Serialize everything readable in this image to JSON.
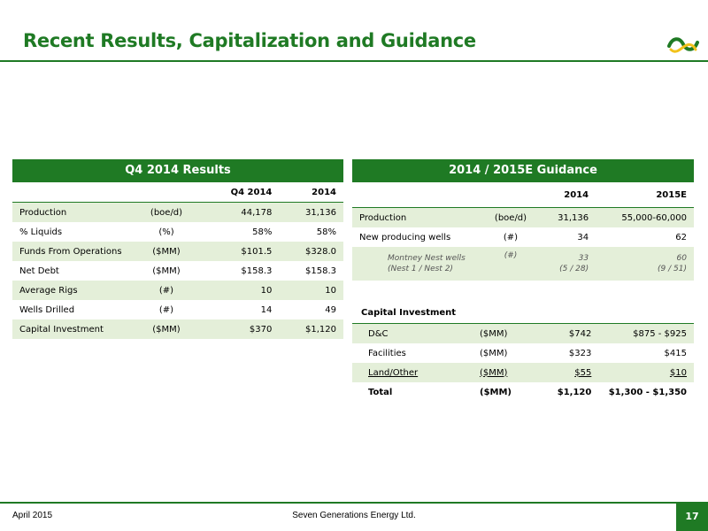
{
  "title": "Recent Results, Capitalization and Guidance",
  "left": {
    "heading": "Q4 2014 Results",
    "columns": [
      "",
      "",
      "Q4 2014",
      "2014"
    ],
    "rows": [
      {
        "label": "Production",
        "unit": "(boe/d)",
        "a": "44,178",
        "b": "31,136"
      },
      {
        "label": "% Liquids",
        "unit": "(%)",
        "a": "58%",
        "b": "58%"
      },
      {
        "label": "Funds From Operations",
        "unit": "($MM)",
        "a": "$101.5",
        "b": "$328.0"
      },
      {
        "label": "Net Debt",
        "unit": "($MM)",
        "a": "$158.3",
        "b": "$158.3"
      },
      {
        "label": "Average Rigs",
        "unit": "(#)",
        "a": "10",
        "b": "10"
      },
      {
        "label": "Wells Drilled",
        "unit": "(#)",
        "a": "14",
        "b": "49"
      },
      {
        "label": "Capital Investment",
        "unit": "($MM)",
        "a": "$370",
        "b": "$1,120"
      }
    ]
  },
  "right": {
    "heading": "2014 / 2015E Guidance",
    "columns": [
      "",
      "",
      "2014",
      "2015E"
    ],
    "rows": [
      {
        "label": "Production",
        "unit": "(boe/d)",
        "a": "31,136",
        "b": "55,000-60,000"
      },
      {
        "label": "New producing wells",
        "unit": "(#)",
        "a": "34",
        "b": "62"
      }
    ],
    "sub": {
      "label1": "Montney Nest wells",
      "label2": "(Nest 1 / Nest 2)",
      "unit": "(#)",
      "a1": "33",
      "a2": "(5 / 28)",
      "b1": "60",
      "b2": "(9 / 51)"
    },
    "capital_label": "Capital Investment",
    "capital_rows": [
      {
        "label": "D&C",
        "unit": "($MM)",
        "a": "$742",
        "b": "$875 - $925"
      },
      {
        "label": "Facilities",
        "unit": "($MM)",
        "a": "$323",
        "b": "$415"
      },
      {
        "label": "Land/Other",
        "unit": "($MM)",
        "a": "$55",
        "b": "$10"
      }
    ],
    "total": {
      "label": "Total",
      "unit": "($MM)",
      "a": "$1,120",
      "b": "$1,300 - $1,350"
    }
  },
  "footer": {
    "date": "April 2015",
    "company": "Seven Generations Energy Ltd.",
    "page": "17"
  },
  "colors": {
    "accent": "#1f7a24",
    "shade": "#e4efd9",
    "logo_yellow": "#f2c21b"
  }
}
